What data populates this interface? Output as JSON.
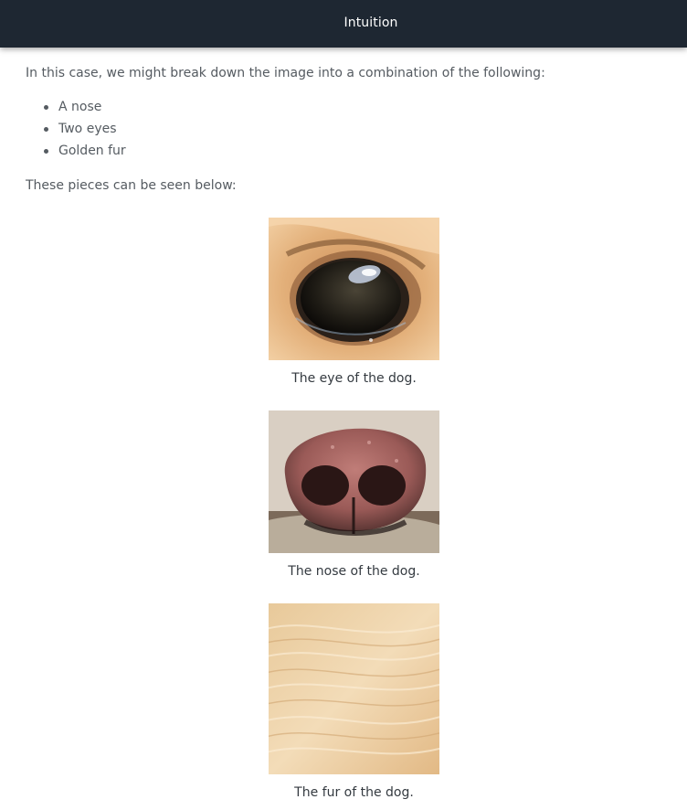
{
  "header": {
    "title": "Intuition"
  },
  "main": {
    "intro": "In this case, we might break down the image into a combination of the following:",
    "list": [
      "A nose",
      "Two eyes",
      "Golden fur"
    ],
    "pieces_intro": "These pieces can be seen below:",
    "figures": [
      {
        "icon": "dog-eye-image",
        "caption": "The eye of the dog."
      },
      {
        "icon": "dog-nose-image",
        "caption": "The nose of the dog."
      },
      {
        "icon": "dog-fur-image",
        "caption": "The fur of the dog."
      }
    ]
  },
  "colors": {
    "header_bg": "#1e2732",
    "body_text": "#555b61",
    "caption_text": "#343a40"
  }
}
